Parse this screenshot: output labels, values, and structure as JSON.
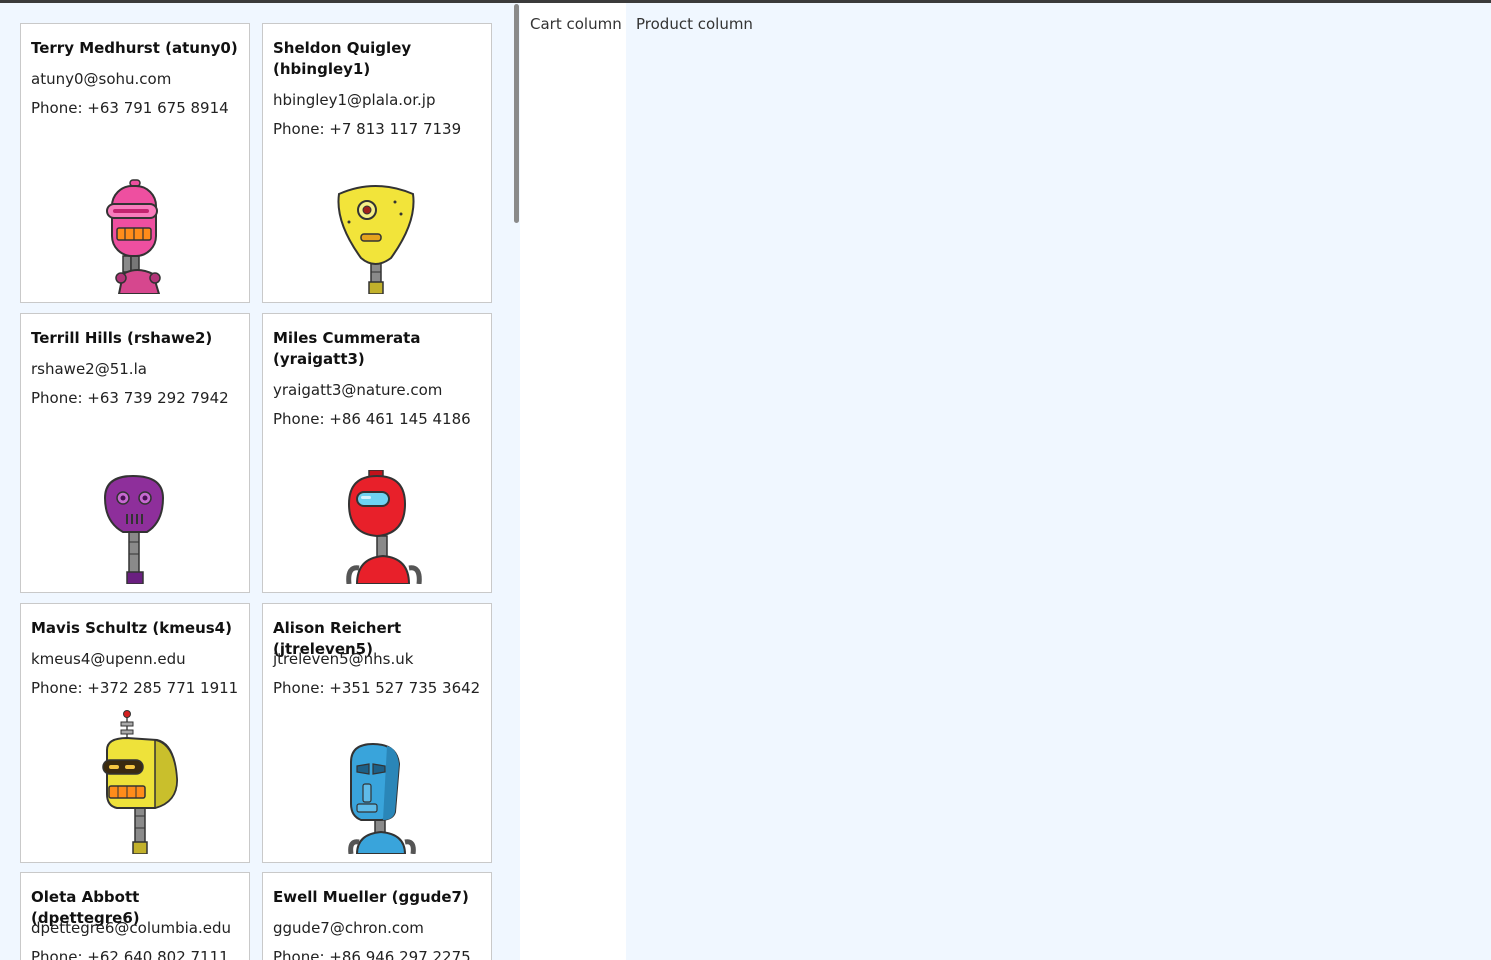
{
  "columns": {
    "cart_label": "Cart column",
    "product_label": "Product column"
  },
  "users": [
    {
      "name": "Terry Medhurst (atuny0)",
      "email": "atuny0@sohu.com",
      "phone": "Phone: +63 791 675 8914",
      "avatar": "pink-robot-icon",
      "color": "#ee4fa0"
    },
    {
      "name": "Sheldon Quigley (hbingley1)",
      "email": "hbingley1@plala.or.jp",
      "phone": "Phone: +7 813 117 7139",
      "avatar": "yellow-cyclops-robot-icon",
      "color": "#f2e43a"
    },
    {
      "name": "Terrill Hills (rshawe2)",
      "email": "rshawe2@51.la",
      "phone": "Phone: +63 739 292 7942",
      "avatar": "purple-robot-icon",
      "color": "#8e2f9b"
    },
    {
      "name": "Miles Cummerata (yraigatt3)",
      "email": "yraigatt3@nature.com",
      "phone": "Phone: +86 461 145 4186",
      "avatar": "red-robot-icon",
      "color": "#e8202a"
    },
    {
      "name": "Mavis Schultz (kmeus4)",
      "email": "kmeus4@upenn.edu",
      "phone": "Phone: +372 285 771 1911",
      "avatar": "yellow-antenna-robot-icon",
      "color": "#eee23a"
    },
    {
      "name": "Alison Reichert (jtreleven5)",
      "email": "jtreleven5@nhs.uk",
      "phone": "Phone: +351 527 735 3642",
      "avatar": "blue-robot-icon",
      "color": "#39a4db"
    },
    {
      "name": "Oleta Abbott (dpettegre6)",
      "email": "dpettegre6@columbia.edu",
      "phone": "Phone: +62 640 802 7111",
      "avatar": "",
      "color": ""
    },
    {
      "name": "Ewell Mueller (ggude7)",
      "email": "ggude7@chron.com",
      "phone": "Phone: +86 946 297 2275",
      "avatar": "",
      "color": ""
    }
  ]
}
